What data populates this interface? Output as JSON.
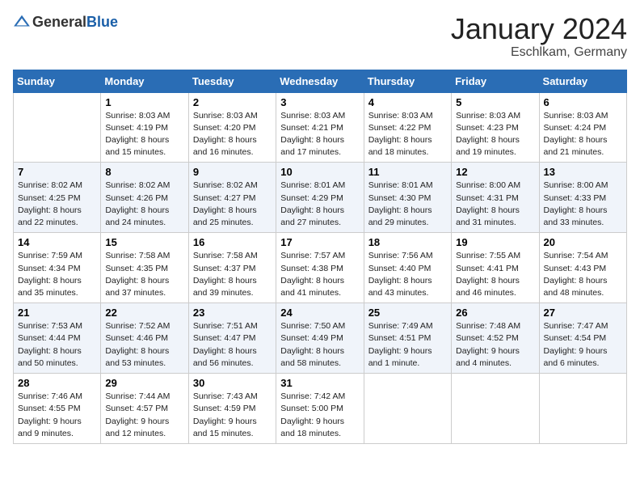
{
  "header": {
    "logo_general": "General",
    "logo_blue": "Blue",
    "month_title": "January 2024",
    "location": "Eschlkam, Germany"
  },
  "calendar": {
    "weekdays": [
      "Sunday",
      "Monday",
      "Tuesday",
      "Wednesday",
      "Thursday",
      "Friday",
      "Saturday"
    ],
    "weeks": [
      [
        {
          "day": "",
          "info": ""
        },
        {
          "day": "1",
          "info": "Sunrise: 8:03 AM\nSunset: 4:19 PM\nDaylight: 8 hours and 15 minutes."
        },
        {
          "day": "2",
          "info": "Sunrise: 8:03 AM\nSunset: 4:20 PM\nDaylight: 8 hours and 16 minutes."
        },
        {
          "day": "3",
          "info": "Sunrise: 8:03 AM\nSunset: 4:21 PM\nDaylight: 8 hours and 17 minutes."
        },
        {
          "day": "4",
          "info": "Sunrise: 8:03 AM\nSunset: 4:22 PM\nDaylight: 8 hours and 18 minutes."
        },
        {
          "day": "5",
          "info": "Sunrise: 8:03 AM\nSunset: 4:23 PM\nDaylight: 8 hours and 19 minutes."
        },
        {
          "day": "6",
          "info": "Sunrise: 8:03 AM\nSunset: 4:24 PM\nDaylight: 8 hours and 21 minutes."
        }
      ],
      [
        {
          "day": "7",
          "info": "Sunrise: 8:02 AM\nSunset: 4:25 PM\nDaylight: 8 hours and 22 minutes."
        },
        {
          "day": "8",
          "info": "Sunrise: 8:02 AM\nSunset: 4:26 PM\nDaylight: 8 hours and 24 minutes."
        },
        {
          "day": "9",
          "info": "Sunrise: 8:02 AM\nSunset: 4:27 PM\nDaylight: 8 hours and 25 minutes."
        },
        {
          "day": "10",
          "info": "Sunrise: 8:01 AM\nSunset: 4:29 PM\nDaylight: 8 hours and 27 minutes."
        },
        {
          "day": "11",
          "info": "Sunrise: 8:01 AM\nSunset: 4:30 PM\nDaylight: 8 hours and 29 minutes."
        },
        {
          "day": "12",
          "info": "Sunrise: 8:00 AM\nSunset: 4:31 PM\nDaylight: 8 hours and 31 minutes."
        },
        {
          "day": "13",
          "info": "Sunrise: 8:00 AM\nSunset: 4:33 PM\nDaylight: 8 hours and 33 minutes."
        }
      ],
      [
        {
          "day": "14",
          "info": "Sunrise: 7:59 AM\nSunset: 4:34 PM\nDaylight: 8 hours and 35 minutes."
        },
        {
          "day": "15",
          "info": "Sunrise: 7:58 AM\nSunset: 4:35 PM\nDaylight: 8 hours and 37 minutes."
        },
        {
          "day": "16",
          "info": "Sunrise: 7:58 AM\nSunset: 4:37 PM\nDaylight: 8 hours and 39 minutes."
        },
        {
          "day": "17",
          "info": "Sunrise: 7:57 AM\nSunset: 4:38 PM\nDaylight: 8 hours and 41 minutes."
        },
        {
          "day": "18",
          "info": "Sunrise: 7:56 AM\nSunset: 4:40 PM\nDaylight: 8 hours and 43 minutes."
        },
        {
          "day": "19",
          "info": "Sunrise: 7:55 AM\nSunset: 4:41 PM\nDaylight: 8 hours and 46 minutes."
        },
        {
          "day": "20",
          "info": "Sunrise: 7:54 AM\nSunset: 4:43 PM\nDaylight: 8 hours and 48 minutes."
        }
      ],
      [
        {
          "day": "21",
          "info": "Sunrise: 7:53 AM\nSunset: 4:44 PM\nDaylight: 8 hours and 50 minutes."
        },
        {
          "day": "22",
          "info": "Sunrise: 7:52 AM\nSunset: 4:46 PM\nDaylight: 8 hours and 53 minutes."
        },
        {
          "day": "23",
          "info": "Sunrise: 7:51 AM\nSunset: 4:47 PM\nDaylight: 8 hours and 56 minutes."
        },
        {
          "day": "24",
          "info": "Sunrise: 7:50 AM\nSunset: 4:49 PM\nDaylight: 8 hours and 58 minutes."
        },
        {
          "day": "25",
          "info": "Sunrise: 7:49 AM\nSunset: 4:51 PM\nDaylight: 9 hours and 1 minute."
        },
        {
          "day": "26",
          "info": "Sunrise: 7:48 AM\nSunset: 4:52 PM\nDaylight: 9 hours and 4 minutes."
        },
        {
          "day": "27",
          "info": "Sunrise: 7:47 AM\nSunset: 4:54 PM\nDaylight: 9 hours and 6 minutes."
        }
      ],
      [
        {
          "day": "28",
          "info": "Sunrise: 7:46 AM\nSunset: 4:55 PM\nDaylight: 9 hours and 9 minutes."
        },
        {
          "day": "29",
          "info": "Sunrise: 7:44 AM\nSunset: 4:57 PM\nDaylight: 9 hours and 12 minutes."
        },
        {
          "day": "30",
          "info": "Sunrise: 7:43 AM\nSunset: 4:59 PM\nDaylight: 9 hours and 15 minutes."
        },
        {
          "day": "31",
          "info": "Sunrise: 7:42 AM\nSunset: 5:00 PM\nDaylight: 9 hours and 18 minutes."
        },
        {
          "day": "",
          "info": ""
        },
        {
          "day": "",
          "info": ""
        },
        {
          "day": "",
          "info": ""
        }
      ]
    ]
  }
}
